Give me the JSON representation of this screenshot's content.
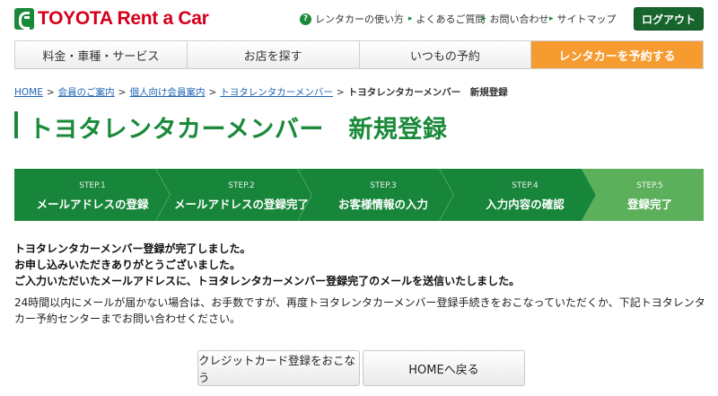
{
  "header": {
    "logo_text": "TOYOTA Rent a Car",
    "help_icon": "question-mark-icon",
    "help_label": "レンタカーの使い方",
    "links": [
      "よくあるご質問",
      "お問い合わせ",
      "サイトマップ"
    ],
    "logout_label": "ログアウト"
  },
  "nav": {
    "items": [
      "料金・車種・サービス",
      "お店を探す",
      "いつもの予約",
      "レンタカーを予約する"
    ]
  },
  "breadcrumb": {
    "items": [
      "HOME",
      "会員のご案内",
      "個人向け会員案内",
      "トヨタレンタカーメンバー"
    ],
    "current": "トヨタレンタカーメンバー　新規登録",
    "separator": ">"
  },
  "page_title": "トヨタレンタカーメンバー　新規登録",
  "steps": [
    {
      "label": "STEP.1",
      "text": "メールアドレスの登録"
    },
    {
      "label": "STEP.2",
      "text": "メールアドレスの登録完了"
    },
    {
      "label": "STEP.3",
      "text": "お客様情報の入力"
    },
    {
      "label": "STEP.4",
      "text": "入力内容の確認"
    },
    {
      "label": "STEP.5",
      "text": "登録完了"
    }
  ],
  "messages": {
    "line1": "トヨタレンタカーメンバー登録が完了しました。",
    "line2": "お申し込みいただきありがとうございました。",
    "line3": "ご入力いただいたメールアドレスに、トヨタレンタカーメンバー登録完了のメールを送信いたしました。",
    "note": "24時間以内にメールが届かない場合は、お手数ですが、再度トヨタレンタカーメンバー登録手続きをおこなっていただくか、下記トヨタレンタカー予約センターまでお問い合わせください。"
  },
  "buttons": {
    "card_label": "クレジットカード登録をおこなう",
    "home_label": "HOMEへ戻る"
  },
  "colors": {
    "brand_green": "#1a8a3a",
    "step_dark": "#17853a",
    "step_active": "#5cb05c",
    "reserve_orange": "#f59b30",
    "logo_red": "#d4001a"
  }
}
